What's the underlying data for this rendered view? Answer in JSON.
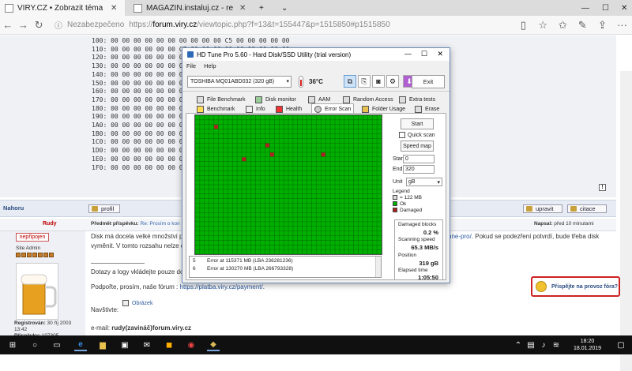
{
  "browser": {
    "tabs": [
      {
        "label": "VIRY.CZ • Zobrazit téma",
        "active": true
      },
      {
        "label": "MAGAZIN.instaluj.cz - recer",
        "active": false
      }
    ],
    "new_tab": "+",
    "url_security": "Nezabezpečeno",
    "url_prefix": "https://",
    "url_host": "forum.viry.cz",
    "url_path": "/viewtopic.php?f=13&t=155447&p=1515850#p1515850"
  },
  "hex_dump": [
    "100: 00 00 00 00 00 00 00 00 00 00 C5 00 00 00 00 00",
    "110: 00 00 00 00 00 00 C7 00 00 00 00 00 00 00 00 00",
    "120: 00 00 00 00 00 00 00 00 00 00 00 00 00 00 00 00",
    "130: 00 00 00 00 00 00 00 00 00 00 00 00 00 00 00 00",
    "140: 00 00 00 00 00 00 00 00 00 00 00 00 00 00 00 00",
    "150: 00 00 00 00 00 00 00 00 00 00 00 00 00 00 00 00",
    "160: 00 00 00 00 00 00 00 00 00 00 00 00 00 00 00 00",
    "170: 00 00 00 00 00 00 00 00 00 00 00 00 00 00 00 00",
    "180: 00 00 00 00 00 00 00 00 00 00 00 00 00 00 00 00",
    "190: 00 00 00 00 00 00 00 00 00 00 00 00 00 00 00 00",
    "1A0: 00 00 00 00 00 00 00 00 00 00 00 00 00 00 00 00",
    "1B0: 00 00 00 00 00 00 00 00 00 00 00 00 00 00 00 00",
    "1C0: 00 00 00 00 00 00 00 00 00 00 00 00 00 00 00 00",
    "1D0: 00 00 00 00 00 00 00 00 00 00 00 00 00 00 00 00",
    "1E0: 00 00 00 00 00 00 00 00 00 00 00 00 00 00 00 00",
    "1F0: 00 00 00 00 00 00 00 00 00 00 00 00 00 00 00 00"
  ],
  "forum": {
    "nahoru": "Nahoru",
    "profil": "profil",
    "upravit": "upravit",
    "citace": "citace",
    "author": "Rudy",
    "predmet_label": "Předmět příspěvku:",
    "predmet_value": "Re: Prosím o kon",
    "napsal_label": "Napsal:",
    "napsal_value": "před 10 minutami",
    "status_badge": "nepřipojen",
    "rank": "Site Admin",
    "registered_label": "Registrován:",
    "registered_value": "30 říj 2003",
    "registered_time": "13:42",
    "posts_label": "Příspěvky:",
    "posts_value": "107305",
    "post_line1_a": "Disk má docela velké množství pos",
    "post_line1_link": "une-pro/",
    "post_line1_b": ". Pokud se podezření potvrdí, bude třeba disk",
    "post_line2": "vyměnit. V tomto rozsahu nelze di",
    "post_line3": "Dotazy a logy vkládejte pouze do v",
    "post_line4_a": "Podpořte, prosím, naše fórum : ",
    "post_line4_link": "https://platba.viry.cz/payment/",
    "post_line4_b": ".",
    "navstivte": "Navštivte:",
    "obrazek": "Obrázek",
    "email_label": "e-mail:",
    "email_value": "rudy(zavináč)forum.viry.cz",
    "donate": "Přispějte na provoz fóra?"
  },
  "hdtune": {
    "title": "HD Tune Pro 5.60 - Hard Disk/SSD Utility (trial version)",
    "menu": [
      "File",
      "Help"
    ],
    "drive": "TOSHIBA MQ01ABD032 (320 gB)",
    "temperature": "36°C",
    "exit": "Exit",
    "tabs_row1": [
      "File Benchmark",
      "Disk monitor",
      "AAM",
      "Random Access",
      "Extra tests"
    ],
    "tabs_row2": [
      "Benchmark",
      "Info",
      "Health",
      "Error Scan",
      "Folder Usage",
      "Erase"
    ],
    "start": "Start",
    "quick_scan": "Quick scan",
    "speed_map": "Speed map",
    "start_label": "Start",
    "start_value": "0",
    "end_label": "End",
    "end_value": "320",
    "unit_label": "Unit",
    "unit_value": "gB",
    "legend_title": "Legend",
    "legend_block": "= 122 MB",
    "legend_ok": "Ok",
    "legend_damaged": "Damaged",
    "damaged_blocks_label": "Damaged blocks",
    "damaged_blocks_value": "0.2 %",
    "scan_speed_label": "Scanning speed",
    "scan_speed_value": "65.3 MB/s",
    "position_label": "Position",
    "position_value": "319 gB",
    "elapsed_label": "Elapsed time",
    "elapsed_value": "1:05:50",
    "errors": [
      {
        "n": "5",
        "text": "Error at 115371 MB (LBA 236281236)"
      },
      {
        "n": "6",
        "text": "Error at 130270 MB (LBA 266793328)"
      }
    ],
    "damaged_cells": [
      [
        4,
        2
      ],
      [
        15,
        6
      ],
      [
        10,
        9
      ],
      [
        16,
        8
      ],
      [
        27,
        8
      ]
    ],
    "colors": {
      "ok": "#00b000",
      "damaged": "#b02020",
      "grid": "#006a00"
    }
  },
  "taskbar": {
    "time": "18:20",
    "date": "18.01.2019"
  }
}
